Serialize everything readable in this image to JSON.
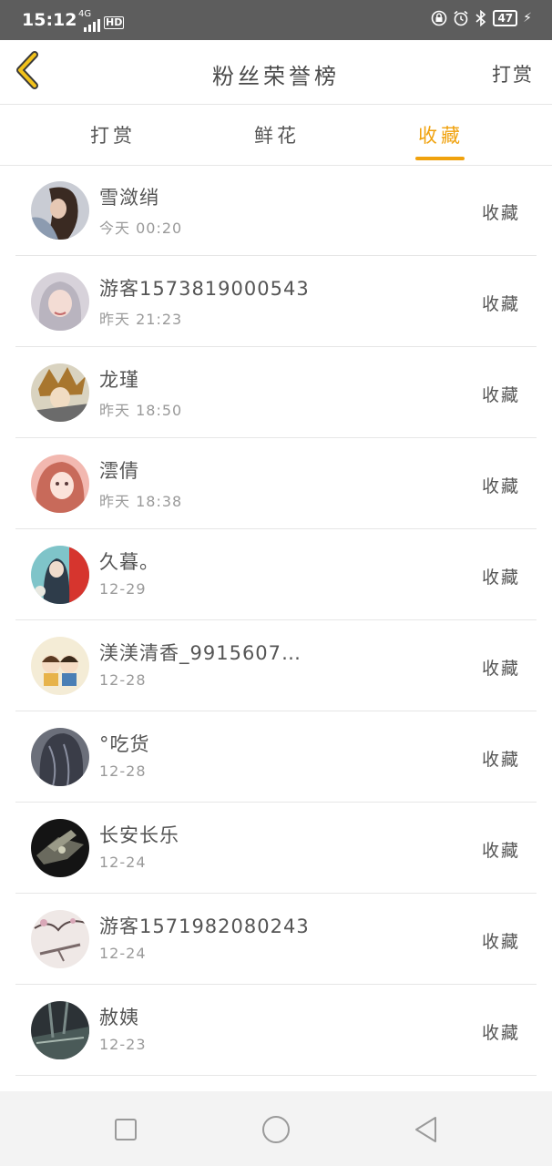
{
  "status_bar": {
    "time": "15:12",
    "network": "4G",
    "hd": "HD",
    "battery": "47"
  },
  "header": {
    "title": "粉丝荣誉榜",
    "action_label": "打赏"
  },
  "tabs": [
    {
      "label": "打赏",
      "active": false
    },
    {
      "label": "鲜花",
      "active": false
    },
    {
      "label": "收藏",
      "active": true
    }
  ],
  "accent_color": "#f0a20e",
  "rows": [
    {
      "name": "雪潋绡",
      "time": "今天 00:20",
      "type": "收藏"
    },
    {
      "name": "游客157381900054​3",
      "time": "昨天 21:23",
      "type": "收藏"
    },
    {
      "name": "龙瑾",
      "time": "昨天 18:50",
      "type": "收藏"
    },
    {
      "name": "澐倩",
      "time": "昨天 18:38",
      "type": "收藏"
    },
    {
      "name": "久暮。",
      "time": "12-29",
      "type": "收藏"
    },
    {
      "name": "渼渼清香_9915607…",
      "time": "12-28",
      "type": "收藏"
    },
    {
      "name": "°吃货",
      "time": "12-28",
      "type": "收藏"
    },
    {
      "name": "长安长乐",
      "time": "12-24",
      "type": "收藏"
    },
    {
      "name": "游客1571982080243",
      "time": "12-24",
      "type": "收藏"
    },
    {
      "name": "赦姨",
      "time": "12-23",
      "type": "收藏"
    }
  ]
}
